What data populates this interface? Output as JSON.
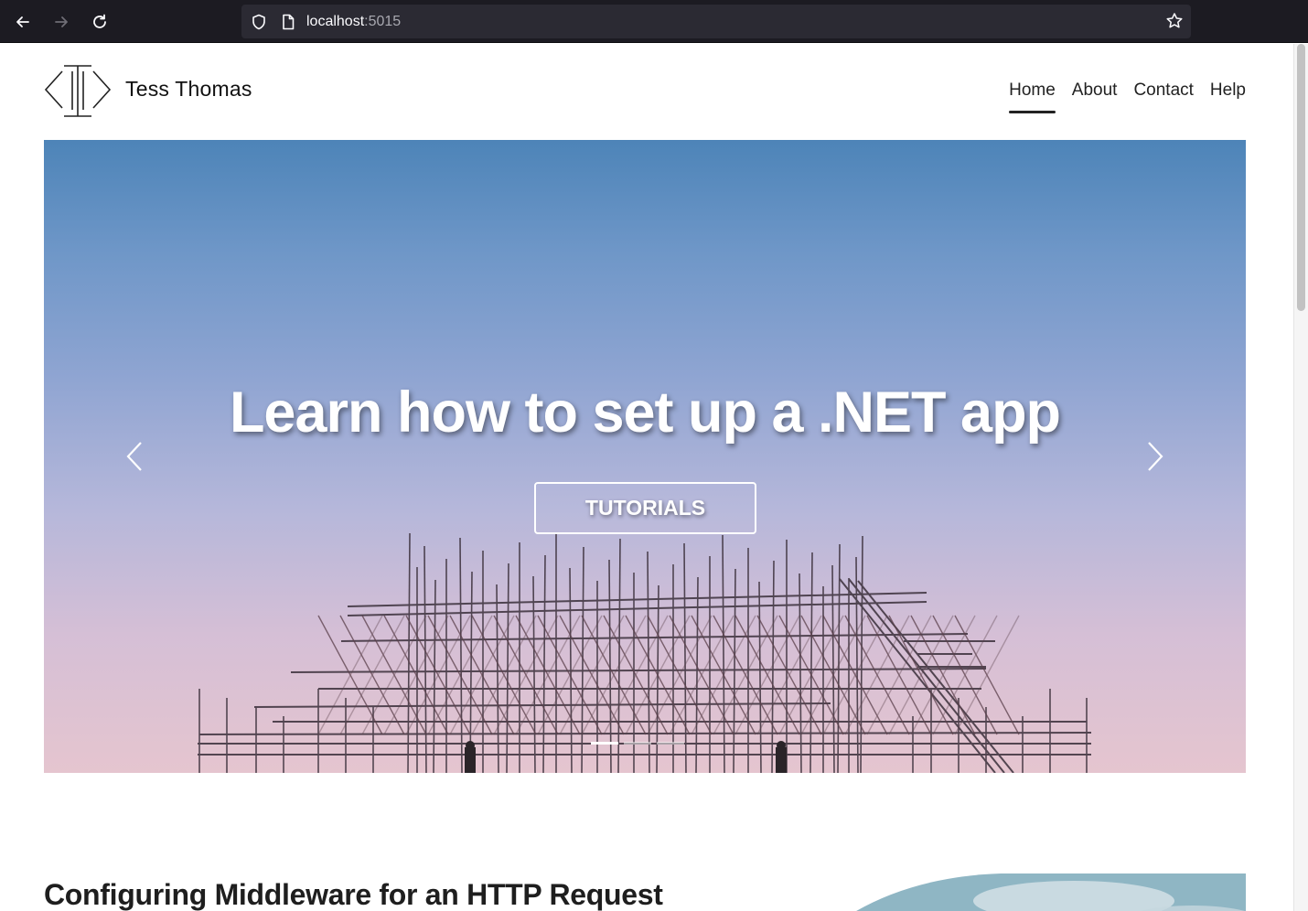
{
  "browser": {
    "url_host": "localhost",
    "url_port": ":5015",
    "icons": [
      "back-arrow-icon",
      "forward-arrow-icon",
      "reload-icon",
      "shield-icon",
      "page-icon",
      "star-icon"
    ]
  },
  "site": {
    "brand": "Tess Thomas",
    "logo": "brackets-logo",
    "nav": [
      {
        "label": "Home",
        "active": true
      },
      {
        "label": "About",
        "active": false
      },
      {
        "label": "Contact",
        "active": false
      },
      {
        "label": "Help",
        "active": false
      }
    ]
  },
  "hero": {
    "heading": "Learn how to set up a .NET app",
    "cta_label": "TUTORIALS",
    "slide_count": 3,
    "active_slide": 1,
    "icons": [
      "chevron-left-icon",
      "chevron-right-icon"
    ]
  },
  "article": {
    "title": "Configuring Middleware for an HTTP Request"
  },
  "colors": {
    "chrome_bg": "#1c1b22",
    "urlbar_bg": "#2b2a33",
    "text": "#222222",
    "sky_top": "#4d84b8",
    "sky_bottom": "#e5c5cf"
  }
}
